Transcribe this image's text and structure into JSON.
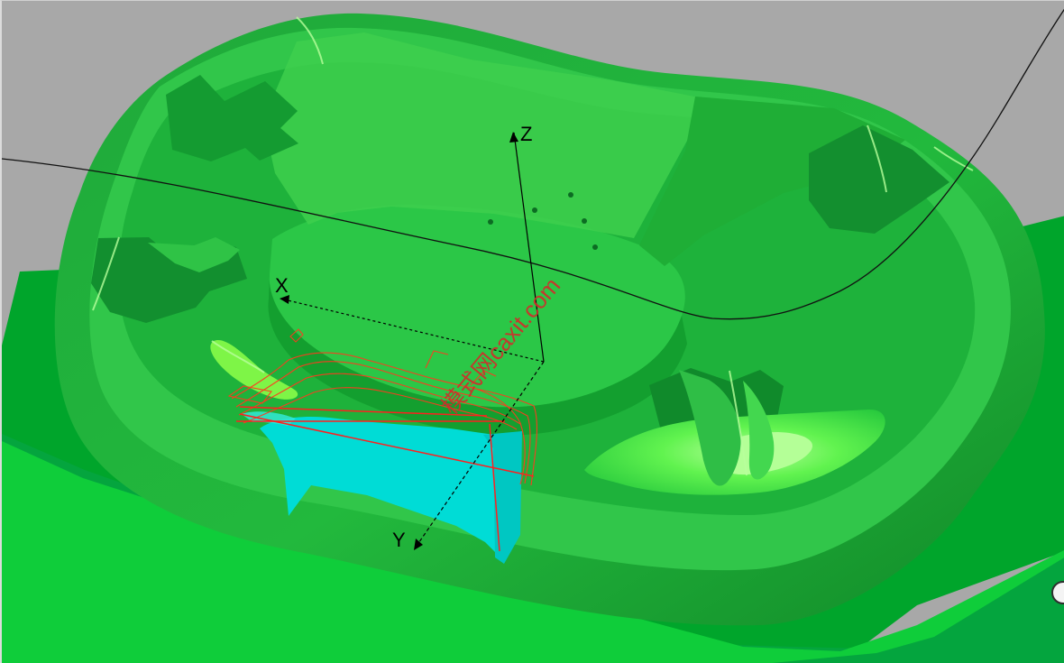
{
  "viewport": {
    "background_color": "#a8a8a8",
    "model_color_main": "#22b93d",
    "model_color_dark": "#159b2d",
    "model_color_light": "#47df4d",
    "highlight_color": "#7dff42",
    "surface_color": "#00dcd6",
    "toolpath_color": "#ff3a1f"
  },
  "axes": {
    "x_label": "X",
    "y_label": "Y",
    "z_label": "Z"
  },
  "watermark": {
    "text": "模式网caxit.com"
  },
  "corner_widget": {
    "icon": "rotation-handle-icon"
  }
}
